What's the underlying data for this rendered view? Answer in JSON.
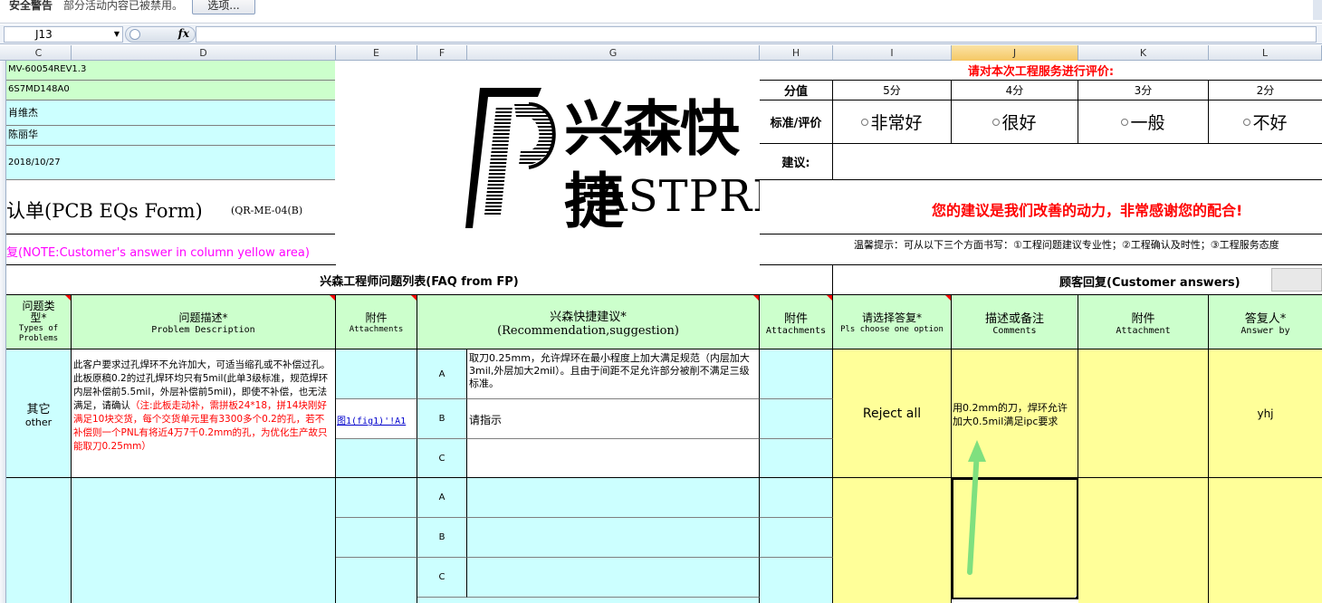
{
  "security_bar": {
    "title": "安全警告",
    "message": "部分活动内容已被禁用。",
    "options_button": "选项..."
  },
  "formula_bar": {
    "cell_ref": "J13",
    "fx_label": "fx",
    "content": ""
  },
  "columns": [
    "C",
    "D",
    "E",
    "F",
    "G",
    "H",
    "I",
    "J",
    "K",
    "L"
  ],
  "selected_column": "J",
  "header_info": {
    "part_no": "MV-60054REV1.3",
    "job_no": "6S7MD148A0",
    "engineer": "肖维杰",
    "contact": "陈丽华",
    "date": "2018/10/27"
  },
  "form_title": {
    "main": "认单(PCB EQs Form)",
    "code": "(QR-ME-04(B)"
  },
  "note": "复(NOTE:Customer's answer in column yellow area)",
  "logo": {
    "chinese": "兴森快捷",
    "english": "FASTPRINT"
  },
  "evaluation": {
    "prompt": "请对本次工程服务进行评价:",
    "score_label": "分值",
    "scores": [
      "5分",
      "4分",
      "3分",
      "2分"
    ],
    "standard_label": "标准/评价",
    "options": [
      "非常好",
      "很好",
      "一般",
      "不好"
    ],
    "suggestion_label": "建议:",
    "thanks": "您的建议是我们改善的动力，非常感谢您的配合!",
    "tip": "温馨提示：可从以下三个方面书写：①工程问题建议专业性；②工程确认及时性；③工程服务态度"
  },
  "sections": {
    "fp_title": "兴森工程师问题列表(FAQ from FP)",
    "customer_title": "顾客回复(Customer answers)"
  },
  "table_headers": {
    "type": "问题类型*",
    "type_en": "Types of Problems",
    "description": "问题描述*",
    "description_en": "Problem Description",
    "attachments": "附件",
    "attachments_en": "Attachments",
    "recommendation": "兴森快捷建议*",
    "recommendation_en": "(Recommendation,suggestion)",
    "attachment2": "附件",
    "attachment2_en": "Attachments",
    "choose": "请选择答复*",
    "choose_en": "Pls choose one option",
    "comments": "描述或备注",
    "comments_en": "Comments",
    "attachment3": "附件",
    "attachment3_en": "Attachment",
    "answer_by": "答复人*",
    "answer_by_en": "Answer by"
  },
  "row1": {
    "type": "其它",
    "type_en": "other",
    "desc_black": "此客户要求过孔焊环不允许加大，可适当缩孔或不补偿过孔。此板原稿0.2的过孔焊环均只有5mil(此单3级标准，规范焊环内层补偿前5.5mil，外层补偿前5mil)，即使不补偿，也无法满足，请确认",
    "desc_red": "（注:此板走动补，需拼板24*18，拼14块刚好满足10块交货，每个交货单元里有3300多个0.2的孔，若不补偿则一个PNL有将近4万7千0.2mm的孔，为优化生产故只能取刀0.25mm）",
    "attachment_link": "图1(fig1)'!A1",
    "options": [
      {
        "letter": "A",
        "text": "取刀0.25mm，允许焊环在最小程度上加大满足规范（内层加大3mil,外层加大2mil）。且由于间距不足允许部分被削不满足三级标准。"
      },
      {
        "letter": "B",
        "text": "请指示"
      },
      {
        "letter": "C",
        "text": ""
      }
    ],
    "answer": "Reject all",
    "comment": "用0.2mm的刀，焊环允许加大0.5mil满足ipc要求",
    "answer_by": "yhj"
  },
  "row2": {
    "options": [
      {
        "letter": "A",
        "text": ""
      },
      {
        "letter": "B",
        "text": ""
      },
      {
        "letter": "C",
        "text": ""
      }
    ]
  }
}
